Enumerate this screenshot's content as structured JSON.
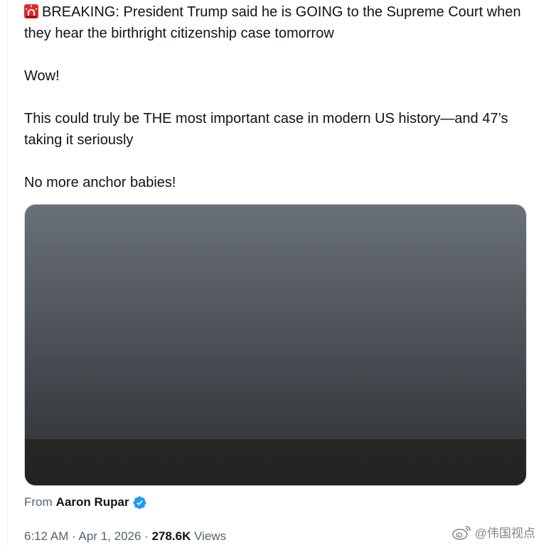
{
  "tweet": {
    "line1": "BREAKING: President Trump said he is GOING to the Supreme Court when they hear the birthright citizenship case tomorrow",
    "line2": "Wow!",
    "line3": "This could truly be THE most important case in modern US history—and 47’s taking it seriously",
    "line4": "No more anchor babies!",
    "emoji_icon": "siren-icon"
  },
  "media": {
    "attribution_label": "From",
    "attribution_name": "Aaron Rupar",
    "verified_icon": "verified-badge-icon"
  },
  "meta": {
    "time": "6:12 AM",
    "sep1": " · ",
    "date": "Apr 1, 2026",
    "sep2": " · ",
    "views_count": "278.6K",
    "views_label": " Views"
  },
  "watermark": {
    "text": "@伟国视点",
    "icon": "weibo-icon"
  },
  "colors": {
    "text": "#0f1419",
    "secondary": "#536471",
    "verified": "#1d9bf0",
    "siren": "#e5252a"
  }
}
